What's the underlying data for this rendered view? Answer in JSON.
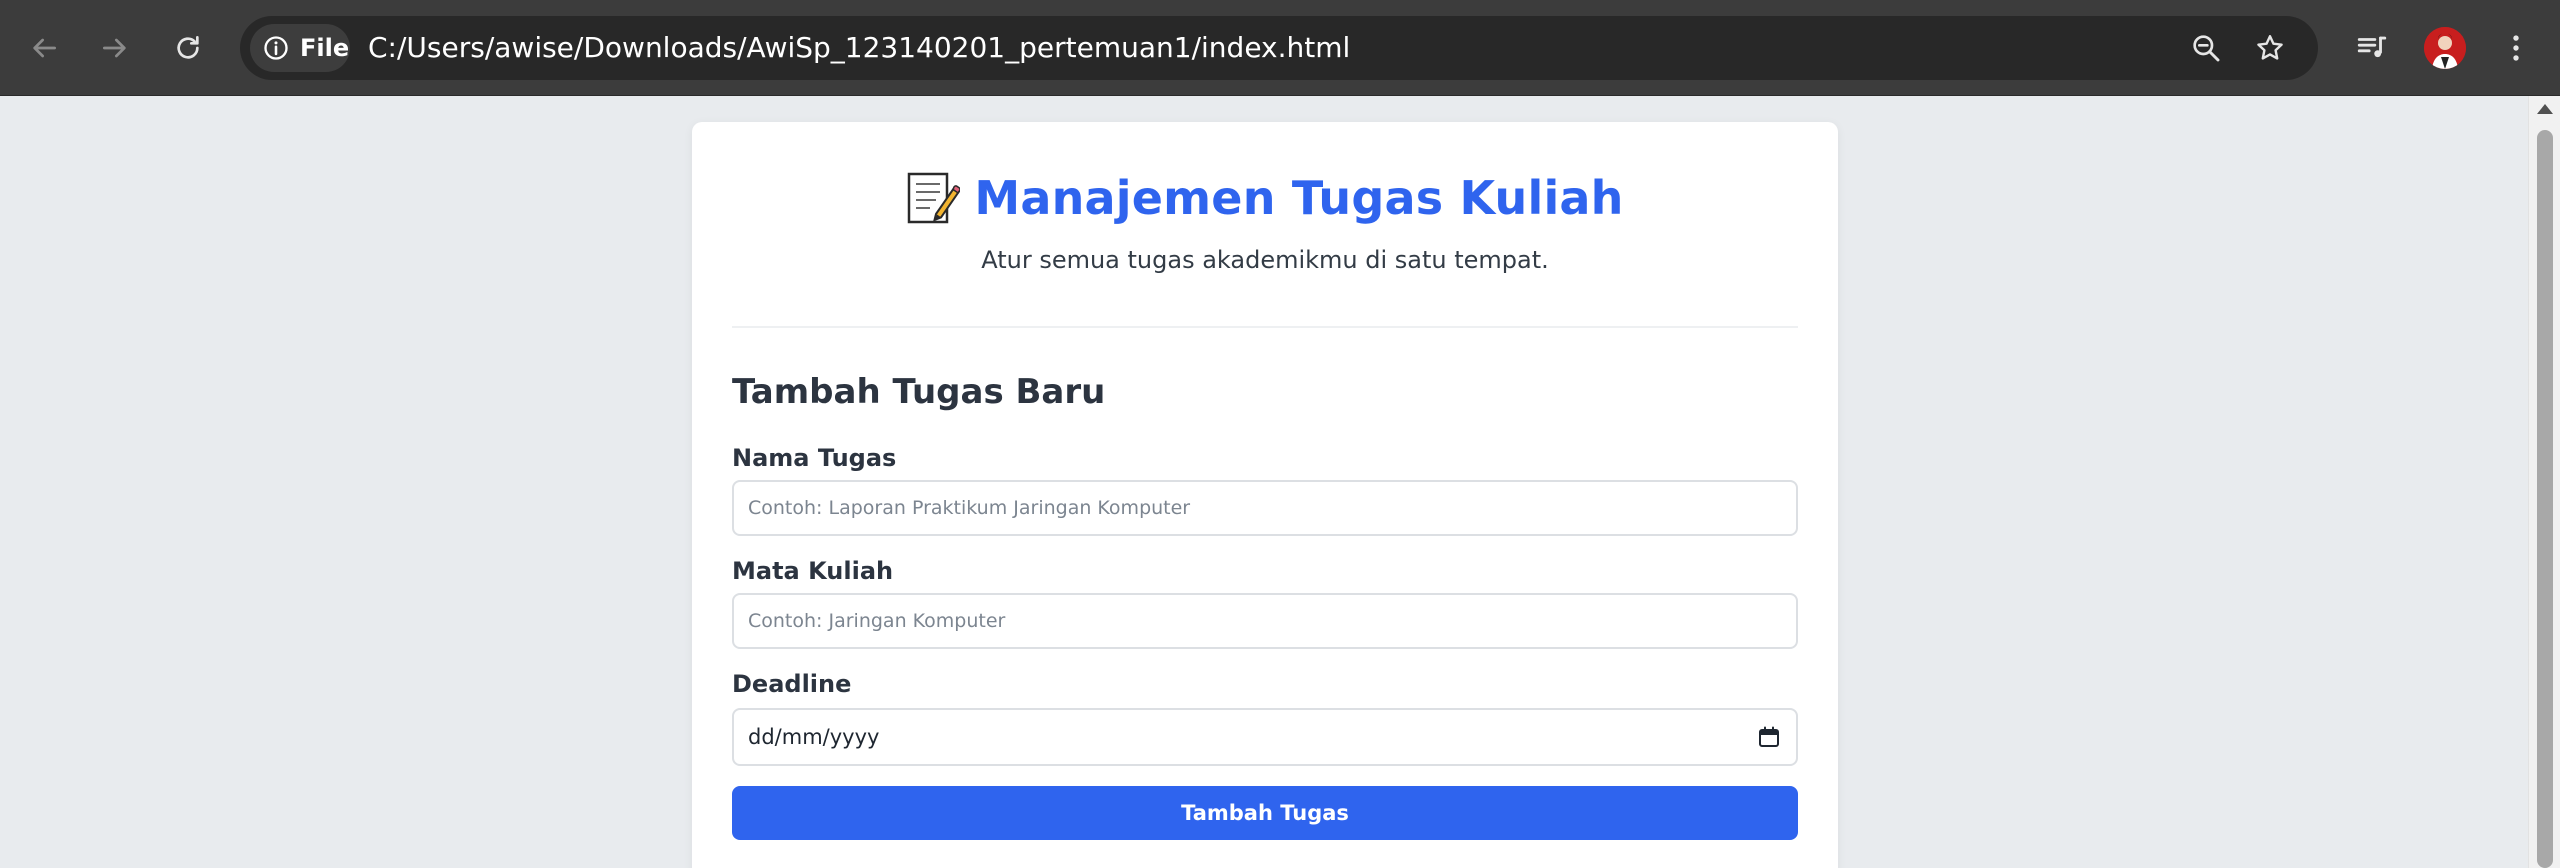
{
  "browser": {
    "site_chip_label": "File",
    "url": "C:/Users/awise/Downloads/AwiSp_123140201_pertemuan1/index.html",
    "icons": {
      "back": "arrow-left-icon",
      "forward": "arrow-right-icon",
      "reload": "reload-icon",
      "site_info": "info-icon",
      "zoom": "zoom-out-icon",
      "bookmark": "star-icon",
      "media": "media-queue-icon",
      "menu": "kebab-menu-icon"
    }
  },
  "page": {
    "header": {
      "title": "Manajemen Tugas Kuliah",
      "subtitle": "Atur semua tugas akademikmu di satu tempat."
    },
    "form": {
      "section_title": "Tambah Tugas Baru",
      "task_name_label": "Nama Tugas",
      "task_name_placeholder": "Contoh: Laporan Praktikum Jaringan Komputer",
      "course_label": "Mata Kuliah",
      "course_placeholder": "Contoh: Jaringan Komputer",
      "deadline_label": "Deadline",
      "deadline_value": "dd/mm/yyyy",
      "submit_label": "Tambah Tugas"
    }
  },
  "colors": {
    "accent": "#2f64ee",
    "background": "#e8ebee",
    "toolbar": "#3c3c3c"
  }
}
